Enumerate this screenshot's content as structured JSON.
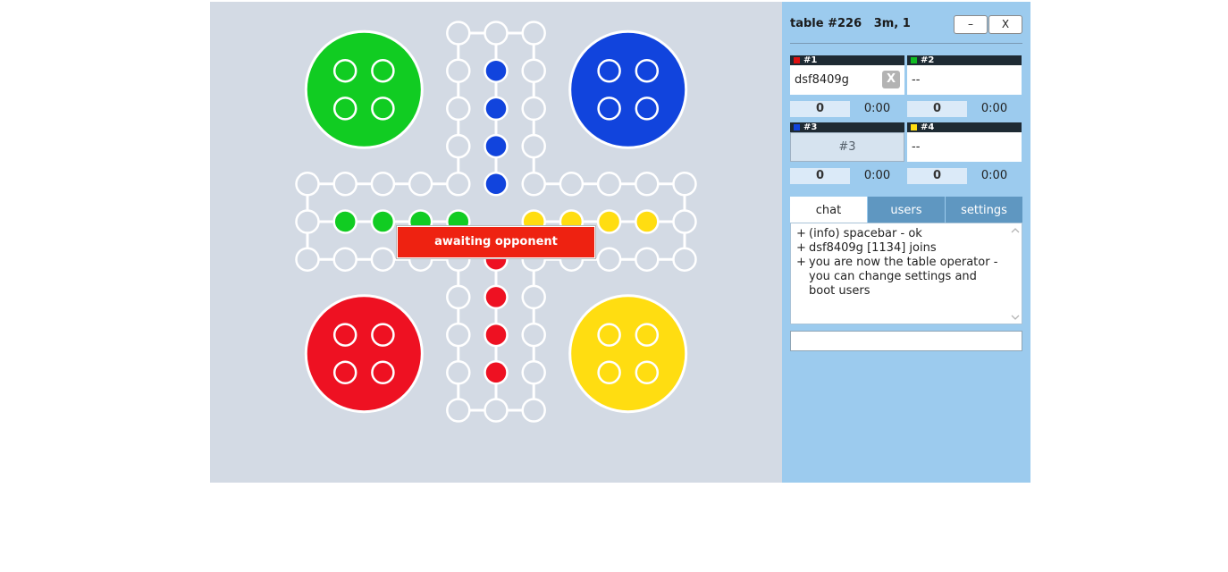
{
  "table": {
    "title": "table #226   3m, 1",
    "minimize_label": "–",
    "close_label": "X"
  },
  "status": "awaiting opponent",
  "colors": {
    "red": "#ee1122",
    "green": "#11cc22",
    "blue": "#1144dd",
    "yellow": "#ffdd11",
    "board": "#d3dae4",
    "panel": "#9ccbee"
  },
  "seats": [
    {
      "label": "#1",
      "color": "#dd1111",
      "player": "dsf8409g",
      "boot_label": "X",
      "score": "0",
      "time": "0:00"
    },
    {
      "label": "#2",
      "color": "#11bb22",
      "player": "--",
      "score": "0",
      "time": "0:00"
    },
    {
      "label": "#3",
      "color": "#1144dd",
      "sit_label": "#3",
      "score": "0",
      "time": "0:00"
    },
    {
      "label": "#4",
      "color": "#ffdd11",
      "player": "--",
      "score": "0",
      "time": "0:00"
    }
  ],
  "tabs": {
    "chat": "chat",
    "users": "users",
    "settings": "settings"
  },
  "chat": [
    "(info) spacebar - ok",
    "dsf8409g [1134] joins",
    "you are now the table operator - you can change settings and boot users"
  ],
  "chat_input": {
    "value": "",
    "placeholder": ""
  },
  "icons": {
    "scroll_up": "chevron-up-icon",
    "scroll_down": "chevron-down-icon"
  }
}
